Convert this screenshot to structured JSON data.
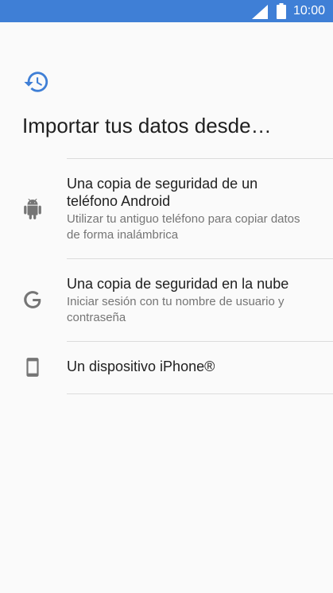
{
  "status_bar": {
    "time": "10:00",
    "signal_icon": "signal-icon",
    "battery_icon": "battery-icon",
    "background_color": "#3f7fd6"
  },
  "header": {
    "icon": "restore-history-icon",
    "icon_color": "#3f7fd6",
    "title": "Importar tus datos desde…"
  },
  "options": [
    {
      "icon": "android-icon",
      "title": "Una copia de seguridad de un teléfono Android",
      "subtitle": "Utilizar tu antiguo teléfono para copiar datos de forma inalámbrica"
    },
    {
      "icon": "google-icon",
      "title": "Una copia de seguridad en la nube",
      "subtitle": "Iniciar sesión con tu nombre de usuario y contraseña"
    },
    {
      "icon": "phone-icon",
      "title": "Un dispositivo iPhone®",
      "subtitle": ""
    }
  ]
}
